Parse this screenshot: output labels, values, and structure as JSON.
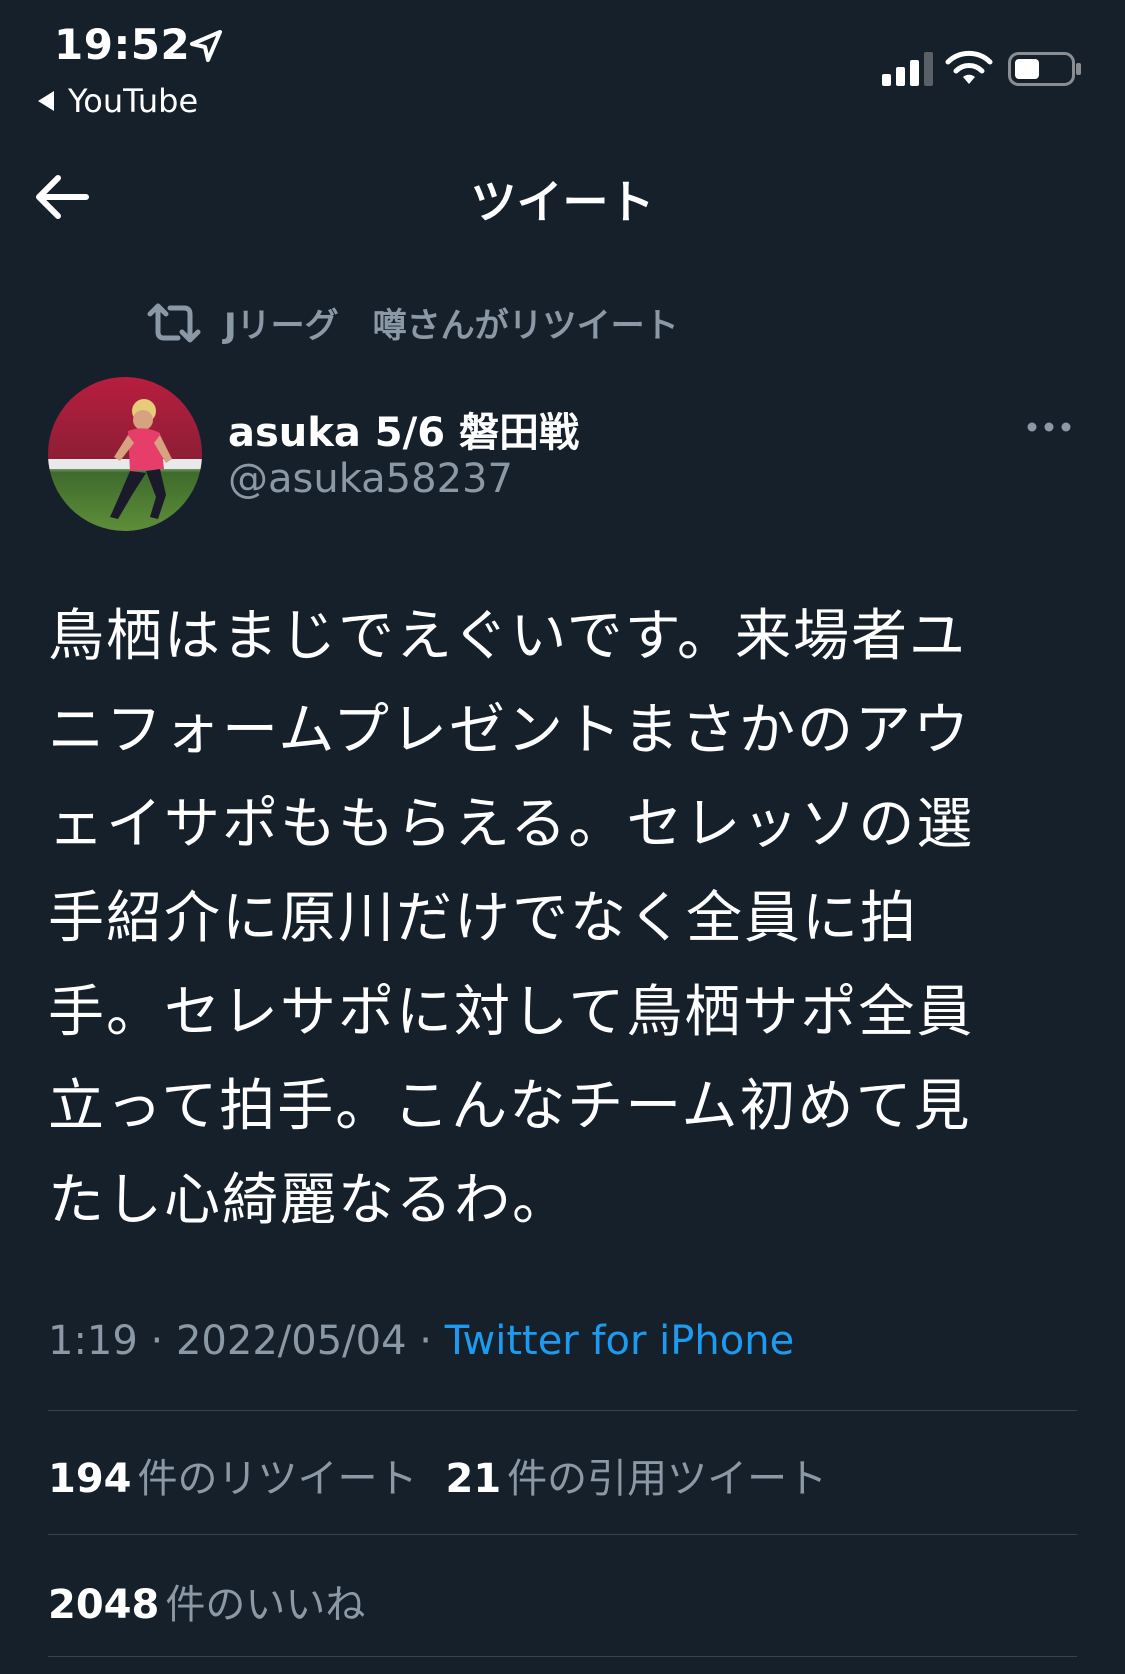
{
  "status_bar": {
    "time": "19:52",
    "back_app": "YouTube",
    "battery_level": 0.45
  },
  "nav": {
    "title": "ツイート"
  },
  "retweet_context": {
    "text": "Jリーグ　噂さんがリツイート"
  },
  "author": {
    "name": "asuka 5/6 磐田戦",
    "handle": "@asuka58237"
  },
  "tweet": {
    "lines": [
      "鳥栖はまじでえぐいです。来場者ユ",
      "ニフォームプレゼントまさかのアウ",
      "ェイサポももらえる。セレッソの選",
      "手紹介に原川だけでなく全員に拍",
      "手。セレサポに対して鳥栖サポ全員",
      "立って拍手。こんなチーム初めて見",
      "たし心綺麗なるわ。"
    ],
    "time": "1:19",
    "sep1": " · ",
    "date": "2022/05/04",
    "sep2": " · ",
    "client": "Twitter for iPhone"
  },
  "stats": {
    "retweets_count": "194",
    "retweets_label": "件のリツイート",
    "quotes_count": "21",
    "quotes_label": "件の引用ツイート",
    "likes_count": "2048",
    "likes_label": "件のいいね"
  },
  "colors": {
    "background": "#15202b",
    "secondary_text": "#8b98a5",
    "link": "#1d9bf0",
    "divider": "#38444d"
  }
}
